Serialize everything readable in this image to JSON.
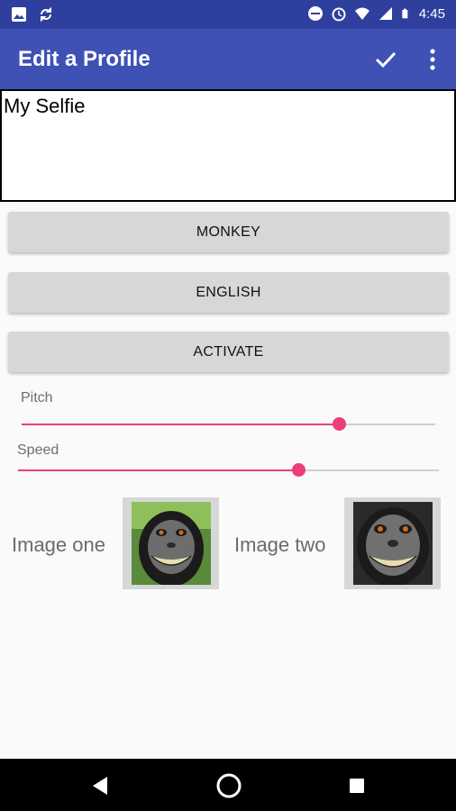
{
  "status_bar": {
    "time": "4:45",
    "icons": [
      "image-icon",
      "sync-icon",
      "do-not-disturb-icon",
      "alarm-icon",
      "wifi-icon",
      "signal-icon",
      "battery-icon"
    ]
  },
  "app_bar": {
    "title": "Edit a Profile",
    "actions": [
      "check-icon",
      "more-vert-icon"
    ],
    "color": "#3f51b5"
  },
  "profile_name": {
    "value": "My Selfie"
  },
  "buttons": {
    "voice": "MONKEY",
    "language": "ENGLISH",
    "activate": "ACTIVATE"
  },
  "sliders": {
    "pitch": {
      "label": "Pitch",
      "value_fraction": 0.76
    },
    "speed": {
      "label": "Speed",
      "value_fraction": 0.67
    },
    "accent_color": "#ea3e7b"
  },
  "images": {
    "one": {
      "label": "Image one"
    },
    "two": {
      "label": "Image two"
    }
  },
  "nav_bar": {
    "buttons": [
      "back-icon",
      "home-icon",
      "recents-icon"
    ]
  }
}
